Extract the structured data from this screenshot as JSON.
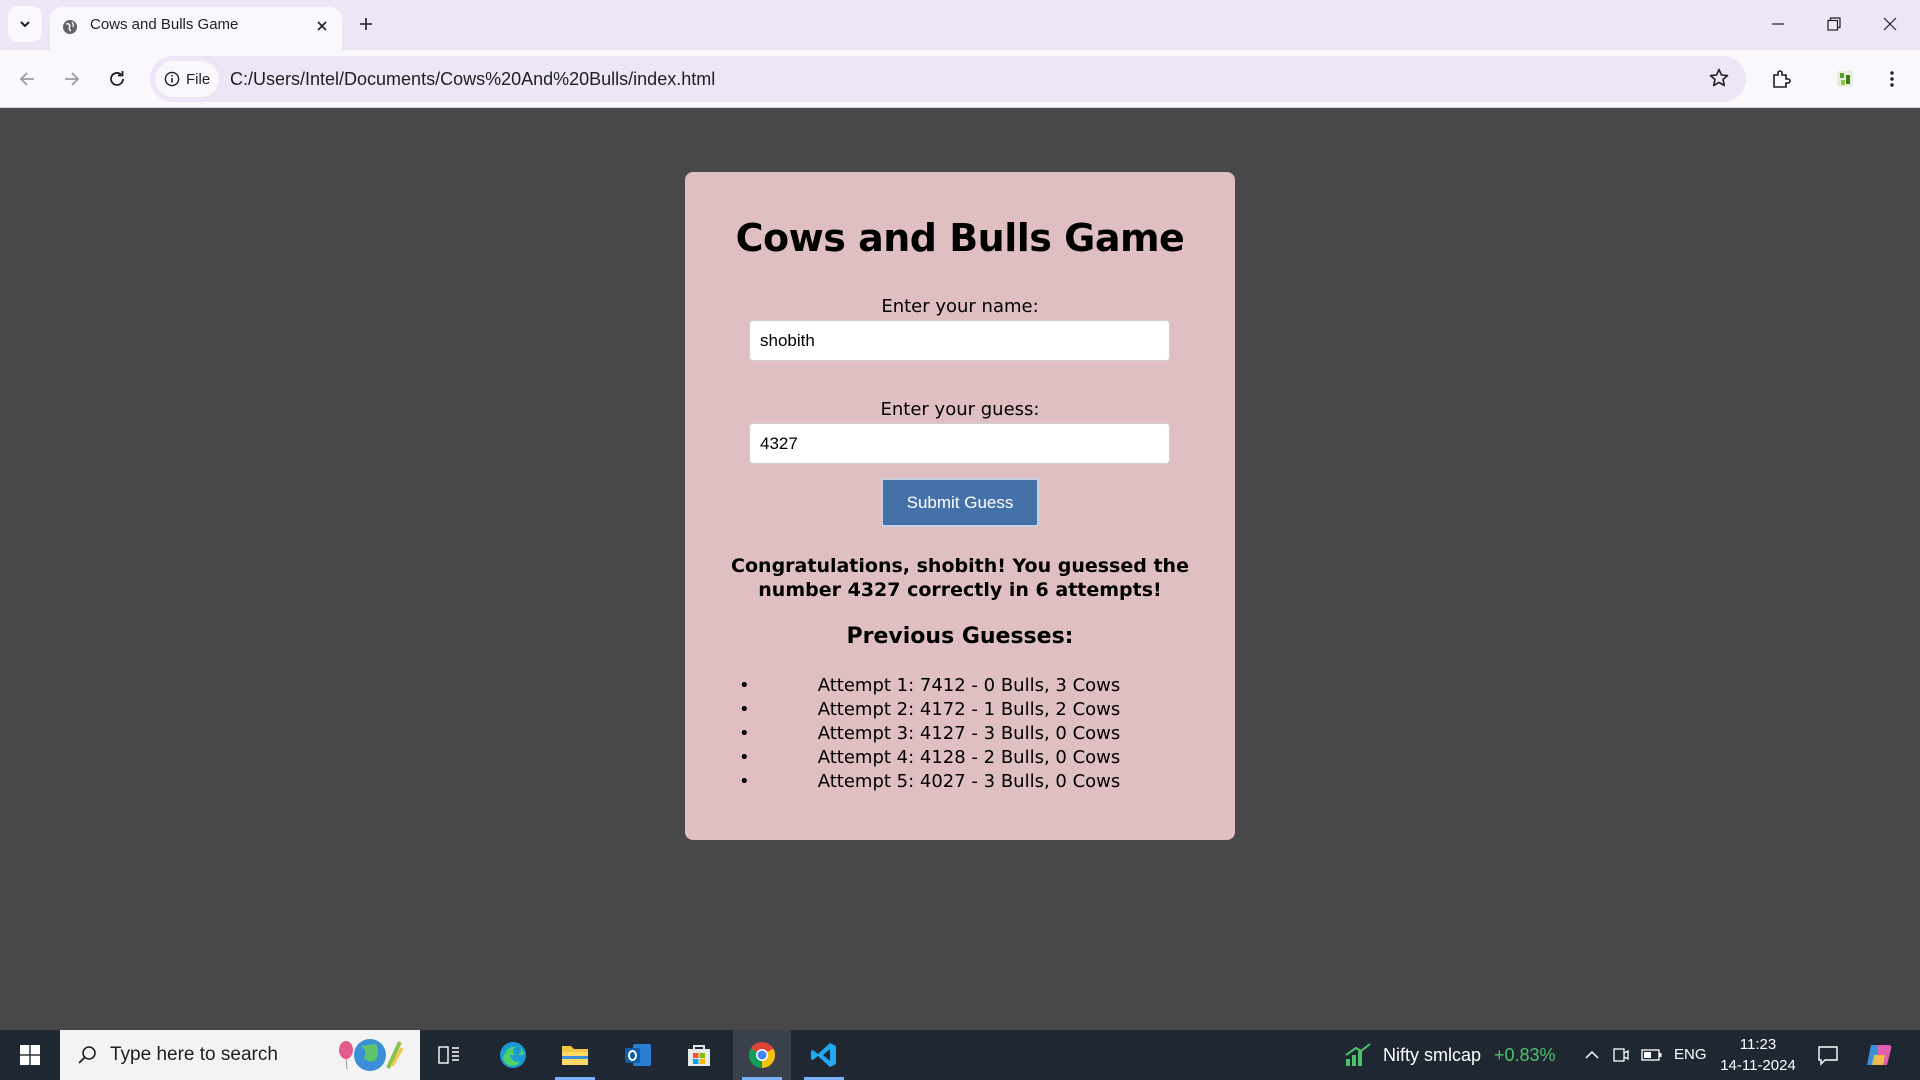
{
  "browser": {
    "tab_title": "Cows and Bulls Game",
    "site_chip_label": "File",
    "url": "C:/Users/Intel/Documents/Cows%20And%20Bulls/index.html"
  },
  "page": {
    "title": "Cows and Bulls Game",
    "name_label": "Enter your name:",
    "name_value": "shobith",
    "guess_label": "Enter your guess:",
    "guess_value": "4327",
    "submit_label": "Submit Guess",
    "result_message": "Congratulations, shobith! You guessed the number 4327 correctly in 6 attempts!",
    "previous_title": "Previous Guesses:",
    "guesses": [
      "Attempt 1: 7412 - 0 Bulls, 3 Cows",
      "Attempt 2: 4172 - 1 Bulls, 2 Cows",
      "Attempt 3: 4127 - 3 Bulls, 0 Cows",
      "Attempt 4: 4128 - 2 Bulls, 0 Cows",
      "Attempt 5: 4027 - 3 Bulls, 0 Cows"
    ]
  },
  "taskbar": {
    "search_placeholder": "Type here to search",
    "stock_name": "Nifty smlcap",
    "stock_change": "+0.83%",
    "language": "ENG",
    "time": "11:23",
    "date": "14-11-2024"
  },
  "colors": {
    "page_background": "#48484b",
    "card_background": "#dfbfc2",
    "button_blue": "#4472a8",
    "stock_green": "#4cc36a"
  }
}
